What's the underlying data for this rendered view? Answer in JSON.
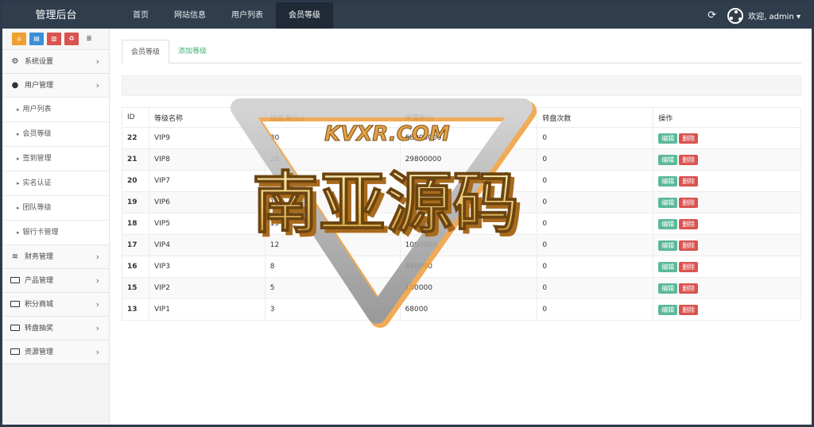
{
  "brand": "管理后台",
  "nav": [
    "首页",
    "网站信息",
    "用户列表",
    "会员等级"
  ],
  "user_menu": "欢迎, admin ▾",
  "sidebar": {
    "shortcuts": [
      {
        "icon": "home-icon",
        "glyph": "⌂",
        "color": "#f0a030"
      },
      {
        "icon": "file-icon",
        "glyph": "▤",
        "color": "#3b8fd6"
      },
      {
        "icon": "trash-icon",
        "glyph": "▥",
        "color": "#d9534f"
      },
      {
        "icon": "recycle-icon",
        "glyph": "♻",
        "color": "#d9534f"
      },
      {
        "icon": "list-icon",
        "glyph": "≣",
        "color": "transparent"
      }
    ],
    "menu": [
      {
        "label": "系统设置",
        "icon": "gears-icon"
      },
      {
        "label": "用户管理",
        "icon": "user-icon"
      }
    ],
    "sub_items": [
      "用户列表",
      "会员等级",
      "签到管理",
      "实名认证",
      "团队等级",
      "银行卡管理"
    ],
    "menu_after": [
      {
        "label": "财务管理",
        "icon": "database-icon"
      },
      {
        "label": "产品管理",
        "icon": "monitor-icon"
      },
      {
        "label": "积分商城",
        "icon": "monitor-icon"
      },
      {
        "label": "转盘抽奖",
        "icon": "monitor-icon"
      },
      {
        "label": "资源管理",
        "icon": "monitor-icon"
      }
    ]
  },
  "tabs": [
    "会员等级",
    "添加等级"
  ],
  "table": {
    "headers": [
      "ID",
      "等级名称",
      "加息率(%)",
      "所需积分",
      "转盘次数",
      "操作"
    ],
    "rows": [
      [
        "22",
        "VIP9",
        "30",
        "68000000",
        "0"
      ],
      [
        "21",
        "VIP8",
        "28",
        "29800000",
        "0"
      ],
      [
        "20",
        "VIP7",
        "22",
        "11800000",
        "0"
      ],
      [
        "19",
        "VIP6",
        "18",
        "5800000",
        "0"
      ],
      [
        "18",
        "VIP5",
        "15",
        "2500000",
        "0"
      ],
      [
        "17",
        "VIP4",
        "12",
        "1000000",
        "0"
      ],
      [
        "16",
        "VIP3",
        "8",
        "450000",
        "0"
      ],
      [
        "15",
        "VIP2",
        "5",
        "180000",
        "0"
      ],
      [
        "13",
        "VIP1",
        "3",
        "68000",
        "0"
      ]
    ],
    "edit_label": "编辑",
    "delete_label": "删除"
  },
  "watermark": {
    "small": "KVXR.COM",
    "big": "南亚源码"
  }
}
